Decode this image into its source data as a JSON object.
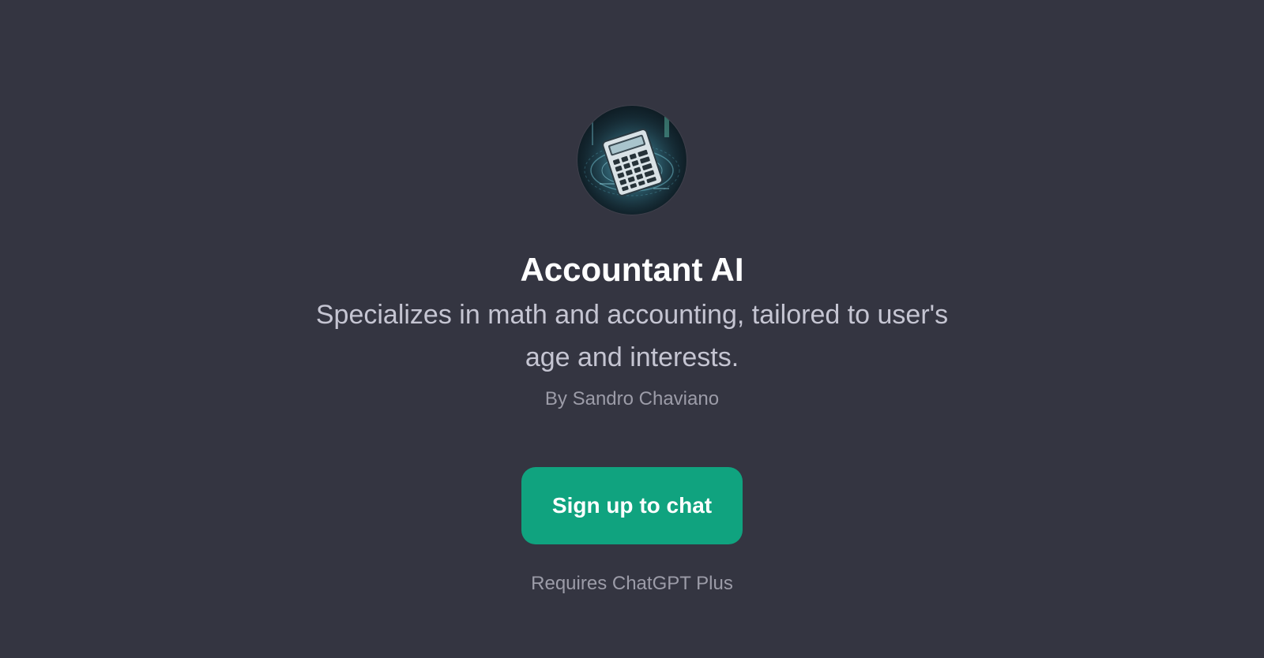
{
  "gpt": {
    "title": "Accountant AI",
    "description": "Specializes in math and accounting, tailored to user's age and interests.",
    "author": "By Sandro Chaviano",
    "avatar_icon": "calculator-avatar-icon"
  },
  "actions": {
    "signup_label": "Sign up to chat"
  },
  "footer": {
    "requirement": "Requires ChatGPT Plus"
  },
  "colors": {
    "background": "#343541",
    "accent": "#10a37f",
    "title": "#ffffff",
    "muted": "#9c9ca8"
  }
}
